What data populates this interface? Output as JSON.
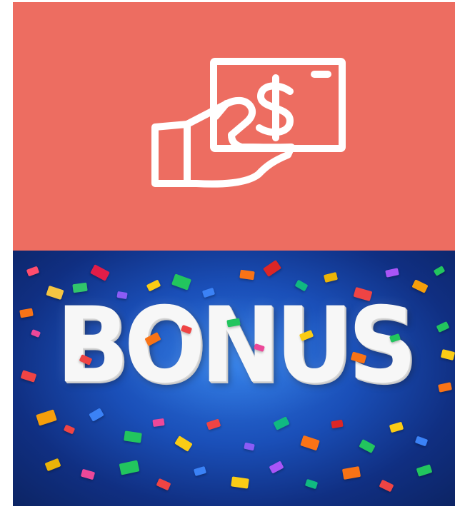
{
  "top_panel": {
    "icon": "hand-holding-banknote-icon",
    "colors": {
      "background": "#ed6d61",
      "icon_stroke": "#ffffff"
    }
  },
  "bottom_panel": {
    "text": "BONUS",
    "colors": {
      "background_primary": "#1a4fb8",
      "text": "#f7f7f7"
    }
  }
}
